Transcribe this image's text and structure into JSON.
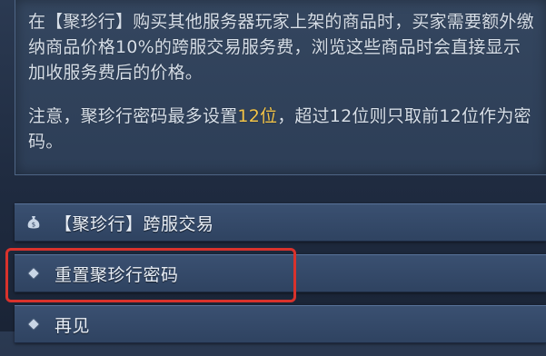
{
  "dialog": {
    "para1": "在【聚珍行】购买其他服务器玩家上架的商品时，买家需要额外缴纳商品价格10%的跨服交易服务费，浏览这些商品时会直接显示加收服务费后的价格。",
    "para2_prefix": "注意，聚珍行密码最多设置",
    "para2_highlight": "12位",
    "para2_suffix": "，超过12位则只取前12位作为密码。"
  },
  "options": [
    {
      "icon": "money-bag-icon",
      "label": "【聚珍行】跨服交易"
    },
    {
      "icon": "diamond-bullet-icon",
      "label": "重置聚珍行密码"
    },
    {
      "icon": "diamond-bullet-icon",
      "label": "再见"
    }
  ],
  "colors": {
    "highlight_text": "#f2c44a",
    "annotation_border": "#d8322c"
  }
}
